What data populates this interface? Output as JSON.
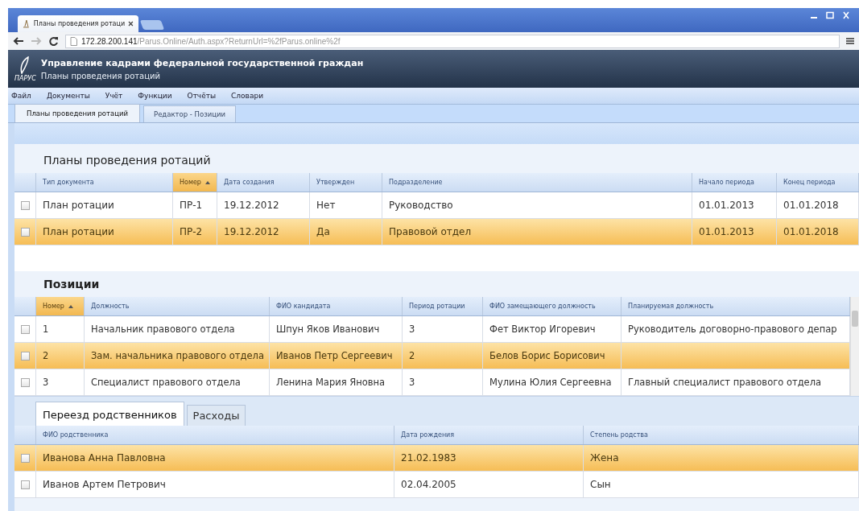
{
  "browser": {
    "tab_title": "Планы проведения ротаци",
    "url_host": "172.28.200.141",
    "url_path": "/Parus.Online/Auth.aspx?ReturnUrl=%2fParus.online%2f"
  },
  "app": {
    "logo_text": "ПАРУС",
    "title": "Управление кадрами федеральной государственной граждан",
    "subtitle": "Планы проведения ротаций"
  },
  "menu": [
    "Файл",
    "Документы",
    "Учёт",
    "Функции",
    "Отчёты",
    "Словари"
  ],
  "tabs": [
    {
      "label": "Планы проведения ротаций",
      "selected": true
    },
    {
      "label": "Редактор - Позиции",
      "selected": false
    }
  ],
  "plans": {
    "title": "Планы проведения ротаций",
    "columns": [
      {
        "label": "Тип документа",
        "sorted": false
      },
      {
        "label": "Номер",
        "sorted": true
      },
      {
        "label": "Дата создания",
        "sorted": false
      },
      {
        "label": "Утвержден",
        "sorted": false
      },
      {
        "label": "Подразделение",
        "sorted": false
      },
      {
        "label": "Начало периода",
        "sorted": false
      },
      {
        "label": "Конец периода",
        "sorted": false
      }
    ],
    "rows": [
      {
        "selected": false,
        "cells": [
          "План ротации",
          "ПР-1",
          "19.12.2012",
          "Нет",
          "Руководство",
          "01.01.2013",
          "01.01.2018"
        ]
      },
      {
        "selected": true,
        "cells": [
          "План ротации",
          "ПР-2",
          "19.12.2012",
          "Да",
          "Правовой отдел",
          "01.01.2013",
          "01.01.2018"
        ]
      }
    ]
  },
  "positions": {
    "title": "Позиции",
    "columns": [
      {
        "label": "Номер",
        "sorted": true
      },
      {
        "label": "Должность",
        "sorted": false
      },
      {
        "label": "ФИО кандидата",
        "sorted": false
      },
      {
        "label": "Период ротации",
        "sorted": false
      },
      {
        "label": "ФИО замещающего должность",
        "sorted": false
      },
      {
        "label": "Планируемая должность",
        "sorted": false
      }
    ],
    "rows": [
      {
        "selected": false,
        "cells": [
          "1",
          "Начальник правового отдела",
          "Шпун Яков Иванович",
          "3",
          "Фет Виктор Игоревич",
          "Руководитель договорно-правового депар"
        ]
      },
      {
        "selected": true,
        "cells": [
          "2",
          "Зам. начальника правового отдела",
          "Иванов Петр Сергеевич",
          "2",
          "Белов Борис Борисович",
          ""
        ]
      },
      {
        "selected": false,
        "cells": [
          "3",
          "Специалист правового отдела",
          "Ленина Мария Яновна",
          "3",
          "Мулина Юлия Сергеевна",
          "Главный специалист правового отдела"
        ]
      }
    ]
  },
  "sub_tabs": [
    {
      "label": "Переезд родственников",
      "selected": true
    },
    {
      "label": "Расходы",
      "selected": false
    }
  ],
  "relatives": {
    "columns": [
      {
        "label": "ФИО родственника",
        "sorted": false
      },
      {
        "label": "Дата рождения",
        "sorted": false
      },
      {
        "label": "Степень родства",
        "sorted": false
      }
    ],
    "rows": [
      {
        "selected": true,
        "cells": [
          "Иванова Анна Павловна",
          "21.02.1983",
          "Жена"
        ]
      },
      {
        "selected": false,
        "cells": [
          "Иванов Артем Петрович",
          "02.04.2005",
          "Сын"
        ]
      }
    ]
  }
}
